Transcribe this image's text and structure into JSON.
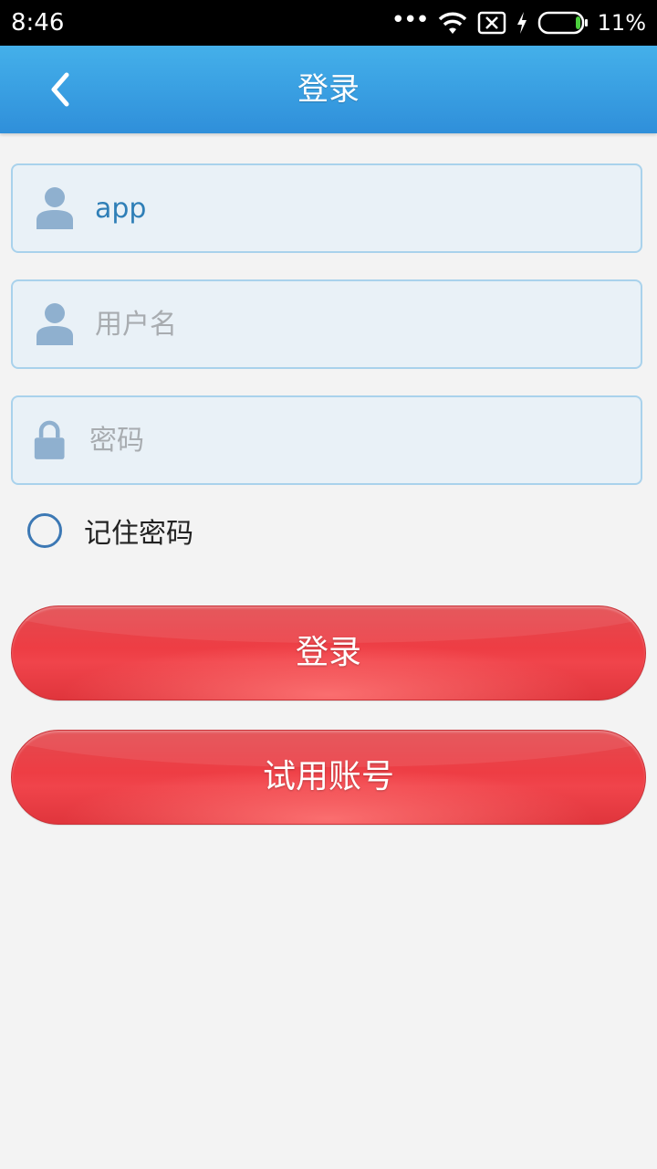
{
  "status_bar": {
    "time": "8:46",
    "dots": "•••",
    "battery_percent": "11%",
    "icons": [
      "wifi-icon",
      "sim-disabled-icon",
      "charging-icon",
      "battery-icon"
    ]
  },
  "header": {
    "title": "登录",
    "back_icon": "chevron-left-icon",
    "background_color": "#3a9fe2"
  },
  "form": {
    "account_field": {
      "value": "app",
      "placeholder": "",
      "icon": "user-icon"
    },
    "username_field": {
      "value": "",
      "placeholder": "用户名",
      "icon": "user-icon"
    },
    "password_field": {
      "value": "",
      "placeholder": "密码",
      "icon": "lock-icon"
    },
    "remember": {
      "label": "记住密码",
      "checked": false
    }
  },
  "buttons": {
    "login_label": "登录",
    "trial_label": "试用账号",
    "color": "#ee3d44"
  }
}
